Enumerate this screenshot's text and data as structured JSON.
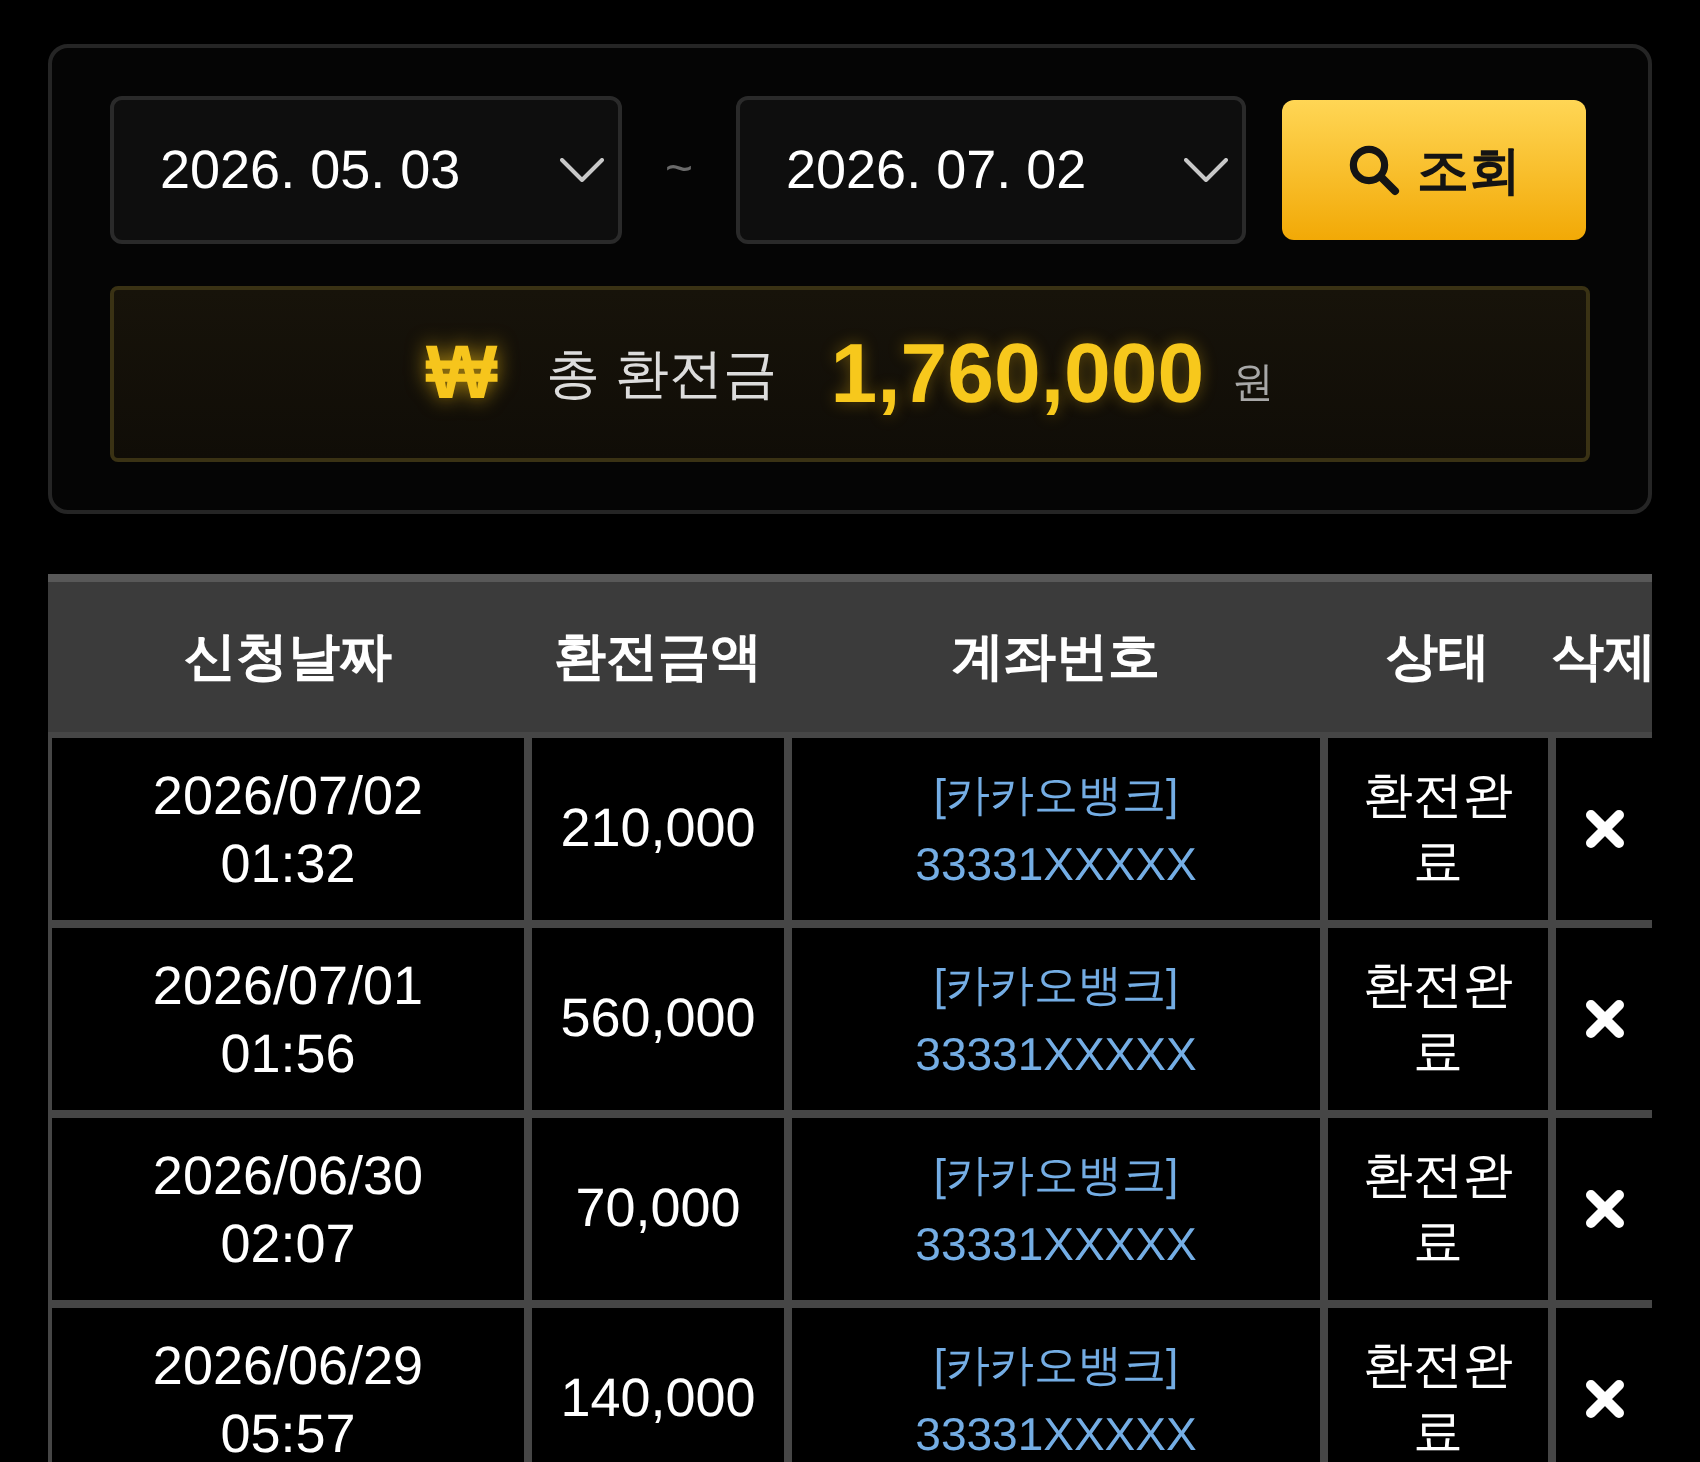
{
  "filter": {
    "start_date": "2026. 05. 03",
    "separator": "~",
    "end_date": "2026. 07. 02",
    "search_button": "조회"
  },
  "summary": {
    "currency_symbol": "₩",
    "label": "총 환전금",
    "amount": "1,760,000",
    "unit": "원"
  },
  "table": {
    "columns": [
      "신청날짜",
      "환전금액",
      "계좌번호",
      "상태",
      "삭제"
    ],
    "rows": [
      {
        "date": "2026/07/02",
        "time": "01:32",
        "amount": "210,000",
        "bank": "[카카오뱅크]",
        "account": "33331XXXXX",
        "status": "환전완료"
      },
      {
        "date": "2026/07/01",
        "time": "01:56",
        "amount": "560,000",
        "bank": "[카카오뱅크]",
        "account": "33331XXXXX",
        "status": "환전완료"
      },
      {
        "date": "2026/06/30",
        "time": "02:07",
        "amount": "70,000",
        "bank": "[카카오뱅크]",
        "account": "33331XXXXX",
        "status": "환전완료"
      },
      {
        "date": "2026/06/29",
        "time": "05:57",
        "amount": "140,000",
        "bank": "[카카오뱅크]",
        "account": "33331XXXXX",
        "status": "환전완료"
      }
    ]
  }
}
